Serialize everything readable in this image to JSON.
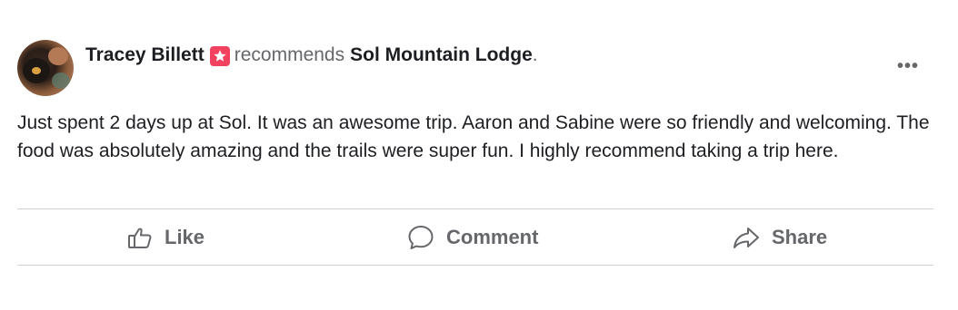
{
  "post": {
    "author": "Tracey Billett",
    "verb": "recommends",
    "page_name": "Sol Mountain Lodge",
    "page_suffix": ".",
    "more_label": "•••",
    "text": "Just spent 2 days up at Sol. It was an awesome trip. Aaron and Sabine were so friendly and welcoming. The food was absolutely amazing and the trails were super fun. I highly recommend taking a trip here."
  },
  "actions": {
    "like": "Like",
    "comment": "Comment",
    "share": "Share"
  },
  "icons": {
    "recommend": "recommend-star-icon",
    "like": "thumbs-up-icon",
    "comment": "comment-bubble-icon",
    "share": "share-arrow-icon",
    "more": "more-options-icon"
  },
  "colors": {
    "text": "#1c1e21",
    "secondary": "#65676b",
    "recommend_badge": "#f3425f",
    "divider": "#ced0d4"
  }
}
